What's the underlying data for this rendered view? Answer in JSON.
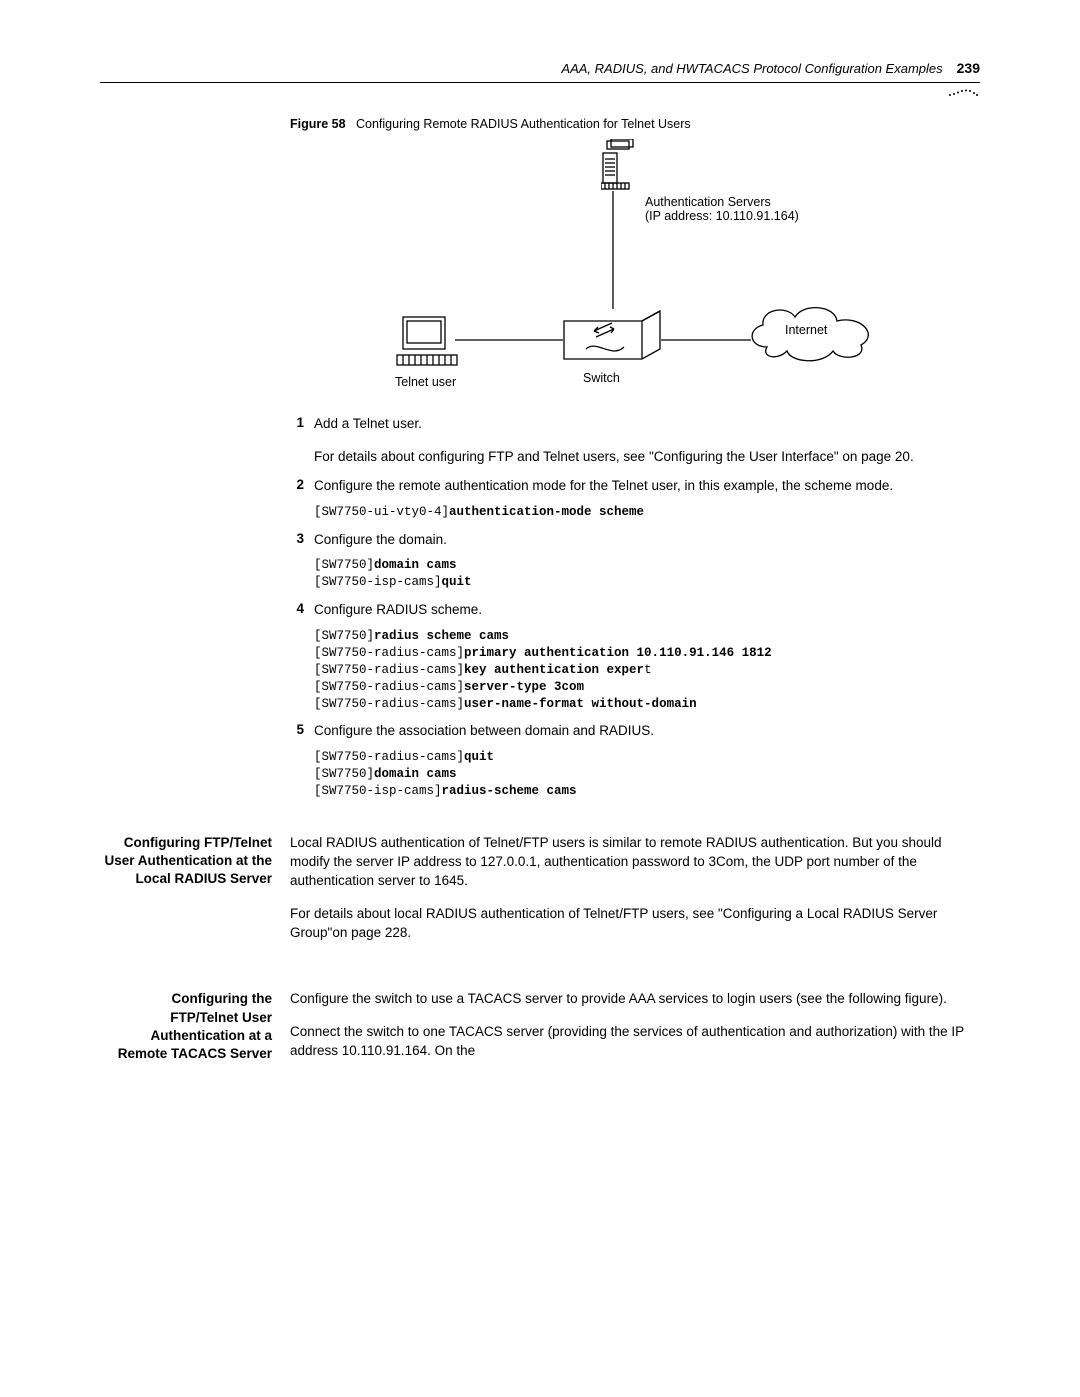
{
  "header": {
    "running_title": "AAA, RADIUS, and HWTACACS Protocol Configuration Examples",
    "page_number": "239"
  },
  "figure": {
    "label": "Figure 58",
    "caption": "Configuring Remote RADIUS Authentication for Telnet Users",
    "auth_servers_line1": "Authentication Servers",
    "auth_servers_line2": "(IP address: 10.110.91.164)",
    "internet": "Internet",
    "switch": "Switch",
    "telnet_user": "Telnet user"
  },
  "steps": {
    "s1": {
      "num": "1",
      "text": "Add a Telnet user.",
      "para": "For details about configuring FTP and Telnet users, see \"Configuring the User Interface\" on page 20."
    },
    "s2": {
      "num": "2",
      "text": "Configure the remote authentication mode for the Telnet user, in this example, the scheme mode.",
      "code_prompt": "[SW7750-ui-vty0-4]",
      "code_cmd": "authentication-mode scheme"
    },
    "s3": {
      "num": "3",
      "text": "Configure the domain.",
      "code_p1": "[SW7750]",
      "code_c1": "domain cams",
      "code_p2": "[SW7750-isp-cams]",
      "code_c2": "quit"
    },
    "s4": {
      "num": "4",
      "text": "Configure RADIUS scheme.",
      "code_p1": "[SW7750]",
      "code_c1": "radius scheme cams",
      "code_p2": "[SW7750-radius-cams]",
      "code_c2": "primary authentication 10.110.91.146 1812",
      "code_p3": "[SW7750-radius-cams]",
      "code_c3a": "key authentication exper",
      "code_c3b": "t",
      "code_p4": "[SW7750-radius-cams]",
      "code_c4": "server-type 3com",
      "code_p5": "[SW7750-radius-cams]",
      "code_c5": "user-name-format without-domain"
    },
    "s5": {
      "num": "5",
      "text": "Configure the association between domain and RADIUS.",
      "code_p1": "[SW7750-radius-cams]",
      "code_c1": "quit",
      "code_p2": "[SW7750]",
      "code_c2": "domain cams",
      "code_p3": "[SW7750-isp-cams]",
      "code_c3": "radius-scheme cams"
    }
  },
  "sec1": {
    "head": "Configuring FTP/Telnet User Authentication at the Local RADIUS Server",
    "p1": "Local RADIUS authentication of Telnet/FTP users is similar to remote RADIUS authentication. But you should modify the server IP address to 127.0.0.1, authentication password to 3Com, the UDP port number of the authentication server to 1645.",
    "p2": "For details about local RADIUS authentication of Telnet/FTP users, see \"Configuring a Local RADIUS Server Group\"on page 228."
  },
  "sec2": {
    "head": "Configuring the FTP/Telnet User Authentication at a Remote TACACS Server",
    "p1": "Configure the switch to use a TACACS server to provide AAA services to login users (see the following figure).",
    "p2": "Connect the switch to one TACACS server (providing the services of authentication and authorization) with the IP address 10.110.91.164. On the"
  }
}
